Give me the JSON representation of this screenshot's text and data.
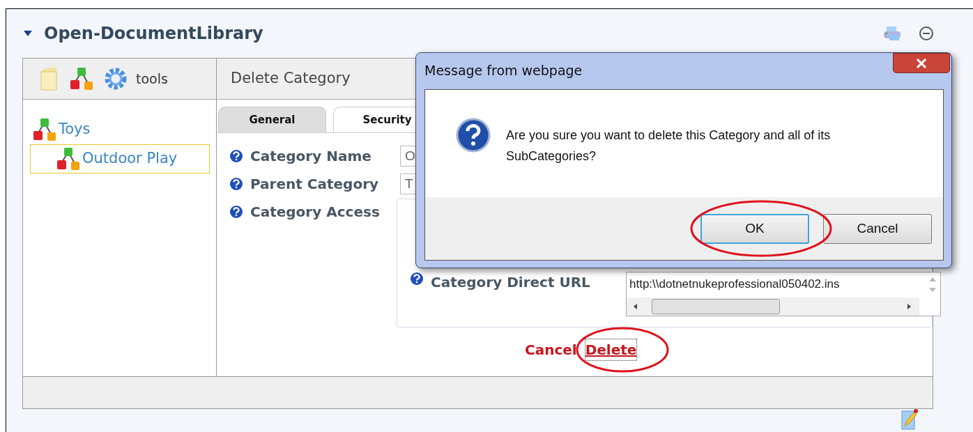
{
  "module": {
    "title": "Open-DocumentLibrary"
  },
  "toolbar": {
    "label": "tools"
  },
  "tree": [
    {
      "label": "Toys",
      "selected": false,
      "children": [
        {
          "label": "Outdoor Play",
          "selected": true
        }
      ]
    }
  ],
  "panel": {
    "title": "Delete Category",
    "tabs": [
      {
        "label": "General",
        "selected": true
      },
      {
        "label": "Security",
        "selected": false
      }
    ],
    "fields": [
      {
        "label": "Category Name",
        "value": "O"
      },
      {
        "label": "Parent Category",
        "value": "T"
      },
      {
        "label": "Category Access"
      }
    ],
    "direct_url": {
      "label": "Category Direct URL",
      "value": "http:\\\\dotnetnukeprofessional050402.ins"
    },
    "links": [
      {
        "label": "Cancel",
        "focused": false
      },
      {
        "label": "Delete",
        "focused": true
      }
    ]
  },
  "dialog": {
    "title": "Message from webpage",
    "message": "Are you sure you want to delete this Category and all of its SubCategories?",
    "buttons": [
      {
        "label": "OK",
        "focused": true
      },
      {
        "label": "Cancel",
        "focused": false
      }
    ]
  }
}
